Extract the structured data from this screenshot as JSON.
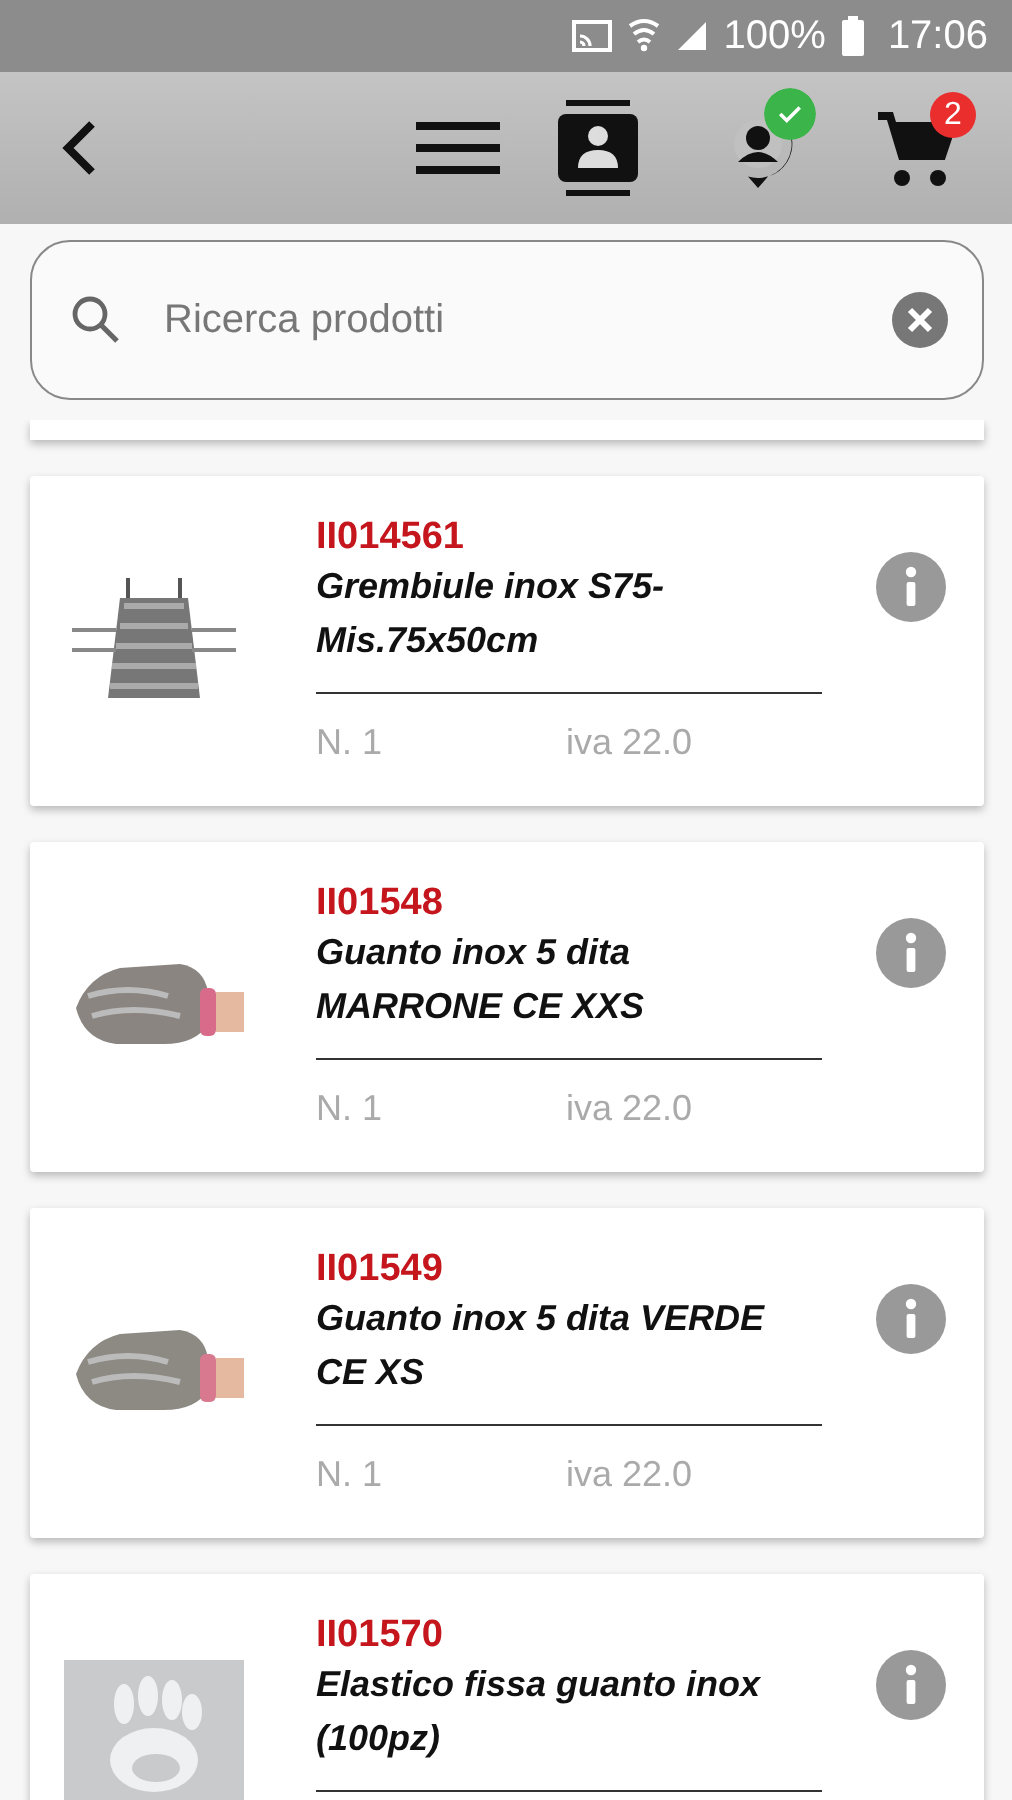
{
  "status_bar": {
    "battery": "100%",
    "time": "17:06"
  },
  "app_bar": {
    "cart_count": "2",
    "profile_verified": true
  },
  "search": {
    "placeholder": "Ricerca prodotti"
  },
  "products": [
    {
      "code": "II014561",
      "name": "Grembiule inox S75-Mis.75x50cm",
      "quantity": "N. 1",
      "vat": "iva 22.0"
    },
    {
      "code": "II01548",
      "name": "Guanto inox 5 dita MARRONE CE XXS",
      "quantity": "N. 1",
      "vat": "iva 22.0"
    },
    {
      "code": "II01549",
      "name": "Guanto inox 5 dita VERDE CE XS",
      "quantity": "N. 1",
      "vat": "iva 22.0"
    },
    {
      "code": "II01570",
      "name": "Elastico fissa guanto inox (100pz)"
    }
  ]
}
